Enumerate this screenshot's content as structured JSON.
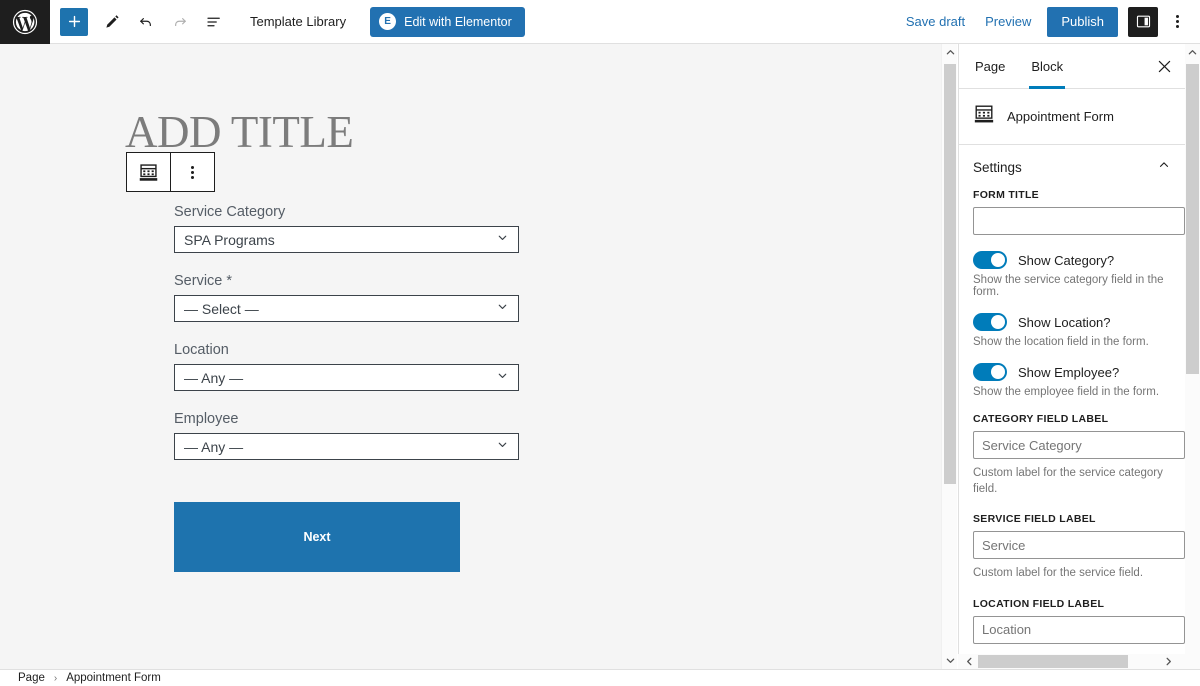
{
  "topbar": {
    "logo_icon": "wordpress-logo-icon",
    "add_block_icon": "plus-icon",
    "tools_icon": "pencil-icon",
    "undo_icon": "undo-arrow-icon",
    "redo_icon": "redo-arrow-icon",
    "listview_icon": "list-view-icon",
    "template_library": "Template Library",
    "elementor_label": "Edit with Elementor",
    "elementor_badge": "E",
    "save_draft": "Save draft",
    "preview": "Preview",
    "publish": "Publish",
    "settings_icon": "sidebar-panel-icon",
    "options_icon": "kebab-menu-icon",
    "accent_blue": "#2271b1",
    "add_block_blue": "#1e73ae"
  },
  "canvas": {
    "post_title": "ADD TITLE",
    "block_toolbar": {
      "block_icon": "appointment-calendar-icon",
      "options_icon": "kebab-menu-icon"
    },
    "form": {
      "fields": [
        {
          "label": "Service Category",
          "required": false,
          "value": "SPA Programs"
        },
        {
          "label": "Service",
          "required": true,
          "value": "— Select —"
        },
        {
          "label": "Location",
          "required": false,
          "value": "— Any —"
        },
        {
          "label": "Employee",
          "required": false,
          "value": "— Any —"
        }
      ],
      "required_marker": "*",
      "next_label": "Next",
      "next_color": "#1e73ae"
    },
    "background": "#f5f5f5"
  },
  "sidebar": {
    "tabs": [
      {
        "label": "Page",
        "active": false
      },
      {
        "label": "Block",
        "active": true
      }
    ],
    "close_icon": "close-x-icon",
    "active_underline": "#007cba",
    "block": {
      "icon": "appointment-calendar-icon",
      "name": "Appointment Form"
    },
    "settings_section": {
      "title": "Settings",
      "collapse_icon": "chevron-up-icon"
    },
    "form_title": {
      "label": "FORM TITLE",
      "value": "",
      "placeholder": ""
    },
    "toggles": [
      {
        "label": "Show Category?",
        "help": "Show the service category field in the form.",
        "on": true
      },
      {
        "label": "Show Location?",
        "help": "Show the location field in the form.",
        "on": true
      },
      {
        "label": "Show Employee?",
        "help": "Show the employee field in the form.",
        "on": true
      }
    ],
    "text_fields": [
      {
        "label": "CATEGORY FIELD LABEL",
        "placeholder": "Service Category",
        "help": "Custom label for the service category field."
      },
      {
        "label": "SERVICE FIELD LABEL",
        "placeholder": "Service",
        "help": "Custom label for the service field."
      },
      {
        "label": "LOCATION FIELD LABEL",
        "placeholder": "Location",
        "help": ""
      }
    ],
    "toggle_color": "#007cba"
  },
  "statusbar": {
    "crumbs": [
      "Page",
      "Appointment Form"
    ],
    "separator": "›"
  }
}
